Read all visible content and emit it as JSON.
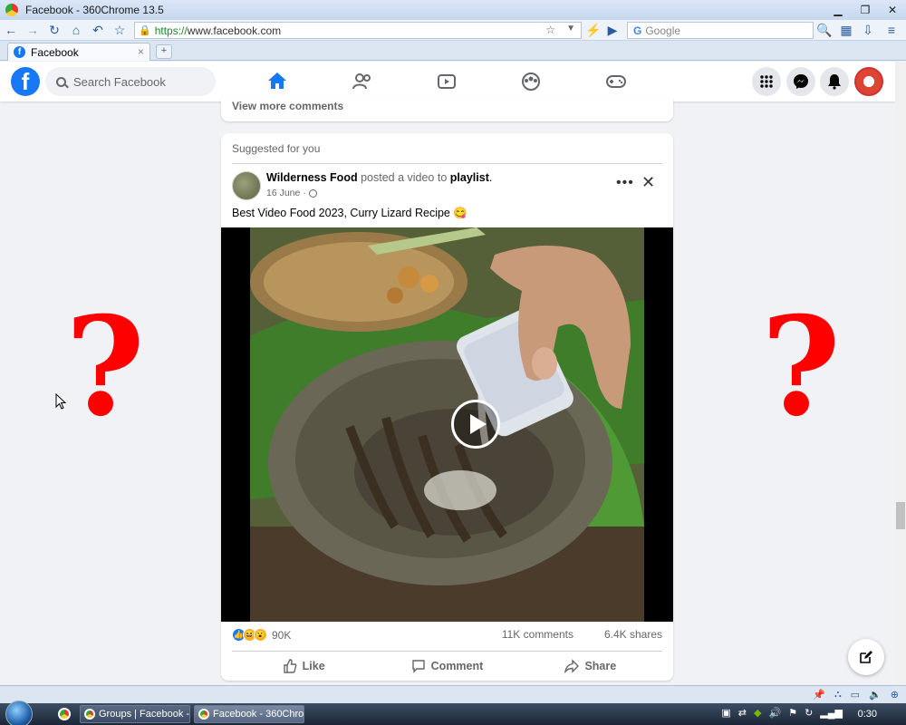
{
  "window": {
    "title": "Facebook - 360Chrome 13.5"
  },
  "browser": {
    "url_scheme": "https://",
    "url_rest": "www.facebook.com",
    "search_placeholder": "Google",
    "tab_title": "Facebook"
  },
  "facebook": {
    "search_placeholder": "Search Facebook",
    "view_more_comments": "View more comments",
    "suggested_label": "Suggested for you",
    "post": {
      "author": "Wilderness Food",
      "action_text": "posted a video to",
      "target": "playlist",
      "date": "16 June",
      "date_separator": "·",
      "caption": "Best Video Food 2023, Curry Lizard Recipe 😋",
      "reaction_count": "90K",
      "comments_count": "11K comments",
      "shares_count": "6.4K shares",
      "actions": {
        "like": "Like",
        "comment": "Comment",
        "share": "Share"
      }
    }
  },
  "overlay": {
    "left_mark": "?",
    "right_mark": "?"
  },
  "taskbar": {
    "tasks": [
      {
        "label": "Groups | Facebook - ..."
      },
      {
        "label": "Facebook - 360Chro..."
      }
    ],
    "clock": "0:30"
  },
  "colors": {
    "facebook_blue": "#1877f2",
    "question_red": "#ff0000"
  }
}
